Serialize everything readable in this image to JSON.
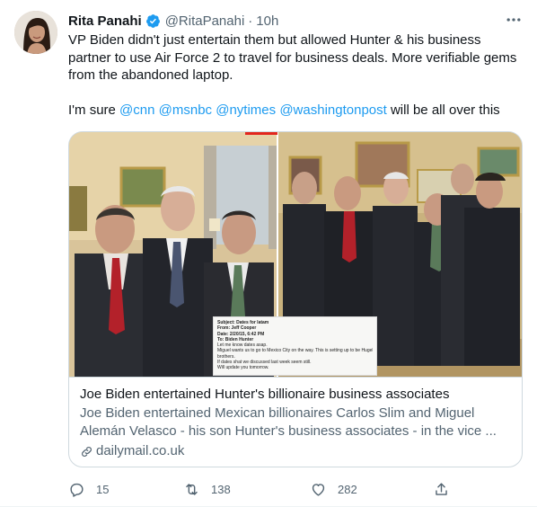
{
  "tweet": {
    "display_name": "Rita Panahi",
    "handle": "@RitaPanahi",
    "separator": "·",
    "time": "10h",
    "verified_icon": "verified-badge-icon",
    "text_line1": "VP Biden didn't just entertain them but allowed Hunter & his business partner to use Air Force 2 to travel for business deals. More verifiable gems from the abandoned laptop.",
    "text_line2_prefix": "I'm sure ",
    "mentions": [
      "@cnn",
      "@msnbc",
      "@nytimes",
      "@washingtonpost"
    ],
    "text_line2_suffix": " will be all over this"
  },
  "card": {
    "title": "Joe Biden entertained Hunter's billionaire business associates",
    "description": "Joe Biden entertained Mexican billionaires Carlos Slim and Miguel Alemán Velasco -  his son Hunter's business associates - in the vice ...",
    "domain": "dailymail.co.uk",
    "email_lines": [
      "Subject: Dates for latam",
      "From: Jeff Cooper",
      "Date: 2/20/15, 6:42 PM",
      "To: Biden Hunter",
      "Let me know dates asap.",
      "Miguel wants us to go to Mexico City on the way. This is setting up to be Hugely gigantic",
      "brothers.",
      "If dates shat we discussed last week seem still.",
      "Will update you tomorrow."
    ]
  },
  "actions": {
    "reply_count": "15",
    "retweet_count": "138",
    "like_count": "282"
  },
  "colors": {
    "accent": "#1d9bf0",
    "secondary_text": "#536471",
    "border": "#cfd9de"
  }
}
